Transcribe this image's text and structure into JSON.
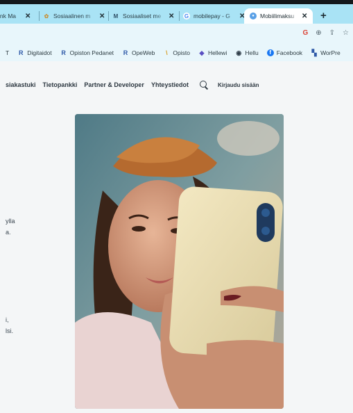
{
  "browser": {
    "tabs": [
      {
        "label": "ink Ma",
        "icon": "page-icon",
        "active": false
      },
      {
        "label": "Sosiaalinen m",
        "icon": "site-icon",
        "active": false
      },
      {
        "label": "Sosiaaliset me",
        "icon": "gmail-icon",
        "active": false
      },
      {
        "label": "mobilepay - G",
        "icon": "google-icon",
        "active": false
      },
      {
        "label": "Mobiilimaksu",
        "icon": "site-icon",
        "active": true
      }
    ],
    "new_tab": "+",
    "bookmarks": [
      {
        "label": "T",
        "icon": "bookmark-icon"
      },
      {
        "label": "Digitaidot",
        "icon": "r-logo-icon"
      },
      {
        "label": "Opiston Pedanet",
        "icon": "r-logo-icon"
      },
      {
        "label": "OpeWeb",
        "icon": "r-logo-icon"
      },
      {
        "label": "Opisto",
        "icon": "opisto-icon"
      },
      {
        "label": "Hellewi",
        "icon": "hellewi-icon"
      },
      {
        "label": "Hellu",
        "icon": "hellu-icon"
      },
      {
        "label": "Facebook",
        "icon": "facebook-icon"
      },
      {
        "label": "WorPre",
        "icon": "wordpress-icon"
      }
    ]
  },
  "nav": {
    "items": [
      "siakastuki",
      "Tietopankki",
      "Partner & Developer",
      "Yhteystiedot"
    ],
    "login": "Kirjaudu sisään"
  },
  "left_fragments": [
    "ylla",
    "a.",
    "i,",
    "lsi."
  ],
  "colors": {
    "tab_strip": "#a9e3f5",
    "page_bg": "#f4f6f7",
    "nav_text": "#2c3740"
  }
}
